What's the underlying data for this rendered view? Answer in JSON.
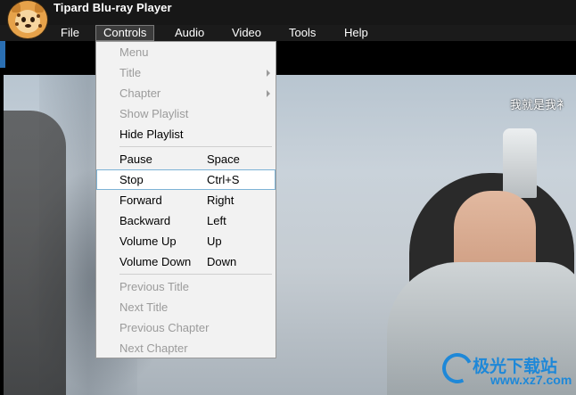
{
  "app": {
    "title": "Tipard Blu-ray Player"
  },
  "menubar": {
    "items": [
      {
        "label": "File"
      },
      {
        "label": "Controls"
      },
      {
        "label": "Audio"
      },
      {
        "label": "Video"
      },
      {
        "label": "Tools"
      },
      {
        "label": "Help"
      }
    ],
    "active": "Controls"
  },
  "controls_menu": {
    "items": [
      {
        "label": "Menu",
        "shortcut": "",
        "enabled": false,
        "submenu": false
      },
      {
        "label": "Title",
        "shortcut": "",
        "enabled": false,
        "submenu": true
      },
      {
        "label": "Chapter",
        "shortcut": "",
        "enabled": false,
        "submenu": true
      },
      {
        "label": "Show Playlist",
        "shortcut": "",
        "enabled": false,
        "submenu": false
      },
      {
        "label": "Hide Playlist",
        "shortcut": "",
        "enabled": true,
        "submenu": false
      },
      {
        "label": "Pause",
        "shortcut": "Space",
        "enabled": true,
        "submenu": false
      },
      {
        "label": "Stop",
        "shortcut": "Ctrl+S",
        "enabled": true,
        "submenu": false,
        "highlighted": true
      },
      {
        "label": "Forward",
        "shortcut": "Right",
        "enabled": true,
        "submenu": false
      },
      {
        "label": "Backward",
        "shortcut": "Left",
        "enabled": true,
        "submenu": false
      },
      {
        "label": "Volume Up",
        "shortcut": "Up",
        "enabled": true,
        "submenu": false
      },
      {
        "label": "Volume Down",
        "shortcut": "Down",
        "enabled": true,
        "submenu": false
      },
      {
        "label": "Previous Title",
        "shortcut": "",
        "enabled": false,
        "submenu": false
      },
      {
        "label": "Next Title",
        "shortcut": "",
        "enabled": false,
        "submenu": false
      },
      {
        "label": "Previous Chapter",
        "shortcut": "",
        "enabled": false,
        "submenu": false
      },
      {
        "label": "Next Chapter",
        "shortcut": "",
        "enabled": false,
        "submenu": false
      }
    ]
  },
  "video": {
    "subtitle": "我就是我衤"
  },
  "watermark": {
    "text": "极光下载站",
    "url": "www.xz7.com"
  },
  "colors": {
    "titlebar": "#171717",
    "menu_bg": "#f2f2f2",
    "disabled_text": "#9b9b9b",
    "highlight_border": "#7db3d6",
    "watermark": "#1e88d8"
  }
}
